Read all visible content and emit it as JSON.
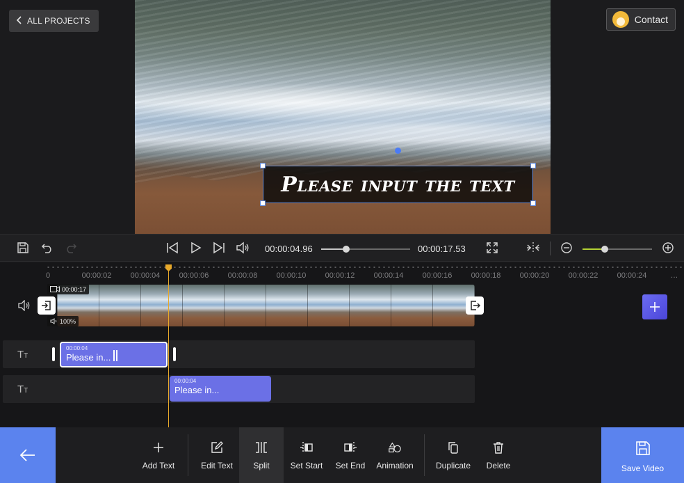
{
  "header": {
    "back_label": "ALL PROJECTS",
    "contact_label": "Contact"
  },
  "preview": {
    "overlay_text": "Please input the text"
  },
  "player": {
    "current_time": "00:00:04.96",
    "duration": "00:00:17.53",
    "progress": 0.283,
    "zoom_level": 0.32
  },
  "timeline": {
    "ruler_labels": [
      "0",
      "00:00:02",
      "00:00:04",
      "00:00:06",
      "00:00:08",
      "00:00:10",
      "00:00:12",
      "00:00:14",
      "00:00:16",
      "00:00:18",
      "00:00:20",
      "00:00:22",
      "00:00:24"
    ],
    "video_clip": {
      "duration": "00:00:17",
      "volume": "100%"
    },
    "text_clips": [
      {
        "time": "00:00:04",
        "label": "Please in..."
      },
      {
        "time": "00:00:04",
        "label": "Please in..."
      }
    ]
  },
  "toolbar": {
    "tools": [
      {
        "label": "Add Text",
        "icon": "plus-icon"
      },
      {
        "label": "Edit Text",
        "icon": "edit-icon"
      },
      {
        "label": "Split",
        "icon": "split-icon"
      },
      {
        "label": "Set Start",
        "icon": "set-start-icon"
      },
      {
        "label": "Set End",
        "icon": "set-end-icon"
      },
      {
        "label": "Animation",
        "icon": "animation-icon"
      },
      {
        "label": "Duplicate",
        "icon": "duplicate-icon"
      },
      {
        "label": "Delete",
        "icon": "trash-icon"
      }
    ],
    "save_label": "Save Video"
  },
  "colors": {
    "accent": "#5b83ee",
    "clip": "#6b70e6",
    "playhead": "#e8a92a",
    "zoom_fill": "#b5d334"
  }
}
